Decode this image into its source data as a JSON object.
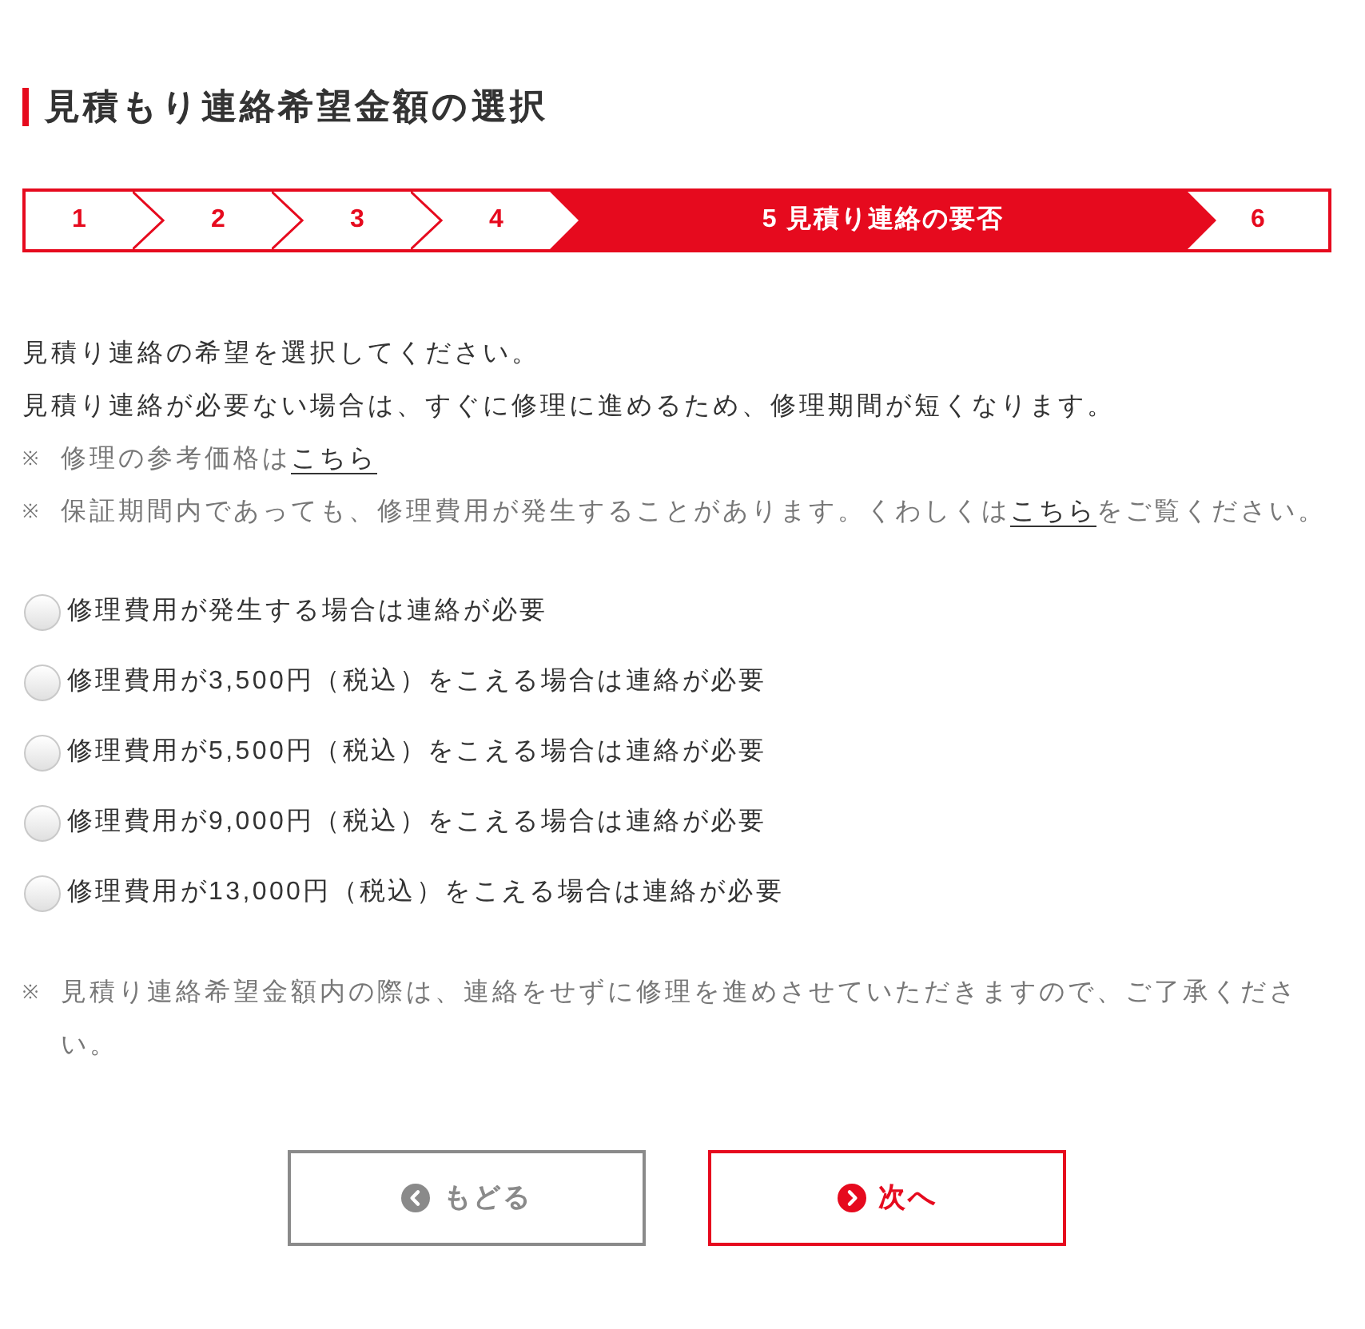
{
  "title": "見積もり連絡希望金額の選択",
  "steps": [
    {
      "label": "1",
      "selected": false
    },
    {
      "label": "2",
      "selected": false
    },
    {
      "label": "3",
      "selected": false
    },
    {
      "label": "4",
      "selected": false
    },
    {
      "label": "5 見積り連絡の要否",
      "selected": true
    },
    {
      "label": "6",
      "selected": false
    }
  ],
  "instructions": [
    "見積り連絡の希望を選択してください。",
    "見積り連絡が必要ない場合は、すぐに修理に進めるため、修理期間が短くなります。"
  ],
  "notes": [
    {
      "mark": "※",
      "segments": [
        {
          "kind": "text",
          "text": "修理の参考価格は"
        },
        {
          "kind": "link",
          "text": "こちら"
        }
      ]
    },
    {
      "mark": "※",
      "segments": [
        {
          "kind": "text",
          "text": "保証期間内であっても、修理費用が発生することがあります。くわしくは"
        },
        {
          "kind": "link",
          "text": "こちら"
        },
        {
          "kind": "text",
          "text": "をご覧ください。"
        }
      ]
    }
  ],
  "options": [
    {
      "label": "修理費用が発生する場合は連絡が必要",
      "selected": false
    },
    {
      "label": "修理費用が3,500円（税込）をこえる場合は連絡が必要",
      "selected": false
    },
    {
      "label": "修理費用が5,500円（税込）をこえる場合は連絡が必要",
      "selected": false
    },
    {
      "label": "修理費用が9,000円（税込）をこえる場合は連絡が必要",
      "selected": false
    },
    {
      "label": "修理費用が13,000円（税込）をこえる場合は連絡が必要",
      "selected": false
    }
  ],
  "footer_note": {
    "mark": "※",
    "segments": [
      {
        "kind": "text",
        "text": "見積り連絡希望金額内の際は、連絡をせずに修理を進めさせていただきますので、ご了承ください。"
      }
    ]
  },
  "buttons": [
    {
      "kind": "back",
      "label": "もどる"
    },
    {
      "kind": "next",
      "label": "次へ"
    }
  ]
}
